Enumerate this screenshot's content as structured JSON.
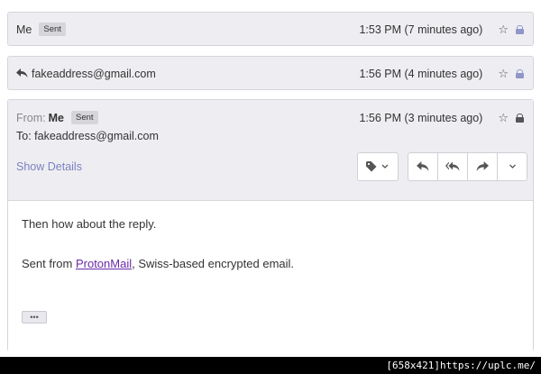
{
  "messages": [
    {
      "sender": "Me",
      "badge": "Sent",
      "time": "1:53 PM (7 minutes ago)"
    },
    {
      "sender": "fakeaddress@gmail.com",
      "time": "1:56 PM (4 minutes ago)"
    }
  ],
  "expanded": {
    "from_label": "From:",
    "from_name": "Me",
    "badge": "Sent",
    "time": "1:56 PM (3 minutes ago)",
    "to_line": "To: fakeaddress@gmail.com",
    "show_details": "Show Details",
    "body_line1": "Then how about the reply.",
    "body_prefix": "Sent from ",
    "body_link": "ProtonMail",
    "body_suffix": ", Swiss-based encrypted email.",
    "dots": "•••"
  },
  "footer": {
    "text": "[658x421]https://uplc.me/"
  },
  "icons": [
    "reply-icon",
    "star-icon",
    "lock-icon",
    "tag-icon",
    "chevron-down-icon",
    "reply-all-icon",
    "forward-icon"
  ],
  "colors": {
    "lock_accent": "#8f97c9",
    "link": "#6a2aa8",
    "show_details": "#7a82c0"
  }
}
